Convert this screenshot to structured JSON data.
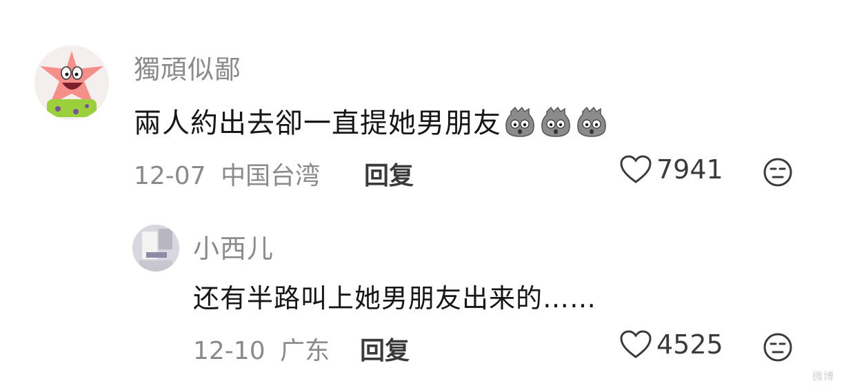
{
  "comments": [
    {
      "username": "獨頑似鄙",
      "text": "兩人約出去卻一直提她男朋友",
      "emoji_icon": "shocked-face-emoji",
      "emoji_count": 3,
      "date": "12-07",
      "location": "中国台湾",
      "reply_label": "回复",
      "likes": "7941"
    },
    {
      "username": "小西儿",
      "text": "还有半路叫上她男朋友出来的……",
      "date": "12-10",
      "location": "广东",
      "reply_label": "回复",
      "likes": "4525"
    }
  ],
  "watermark": "微博"
}
